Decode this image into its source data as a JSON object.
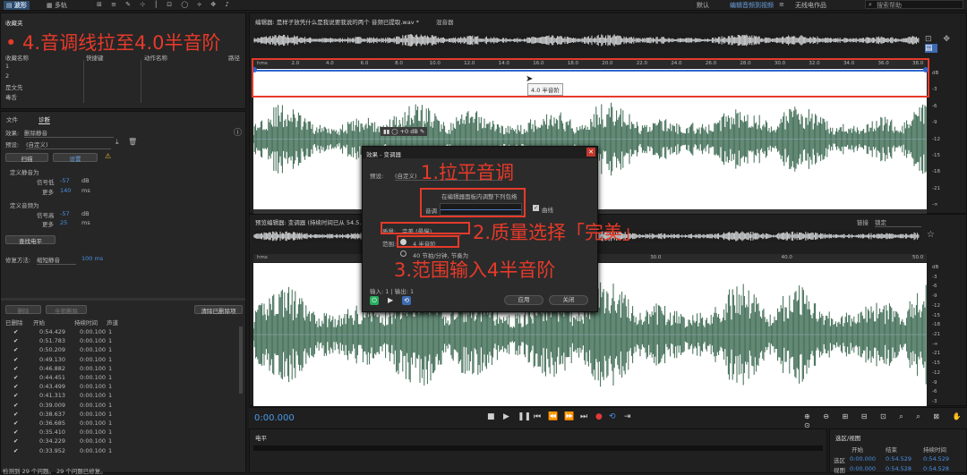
{
  "topbar": {
    "waveform_label": "波形",
    "multitrack_label": "多轨",
    "default_label": "默认",
    "workspace_label": "编辑音频到视频",
    "wireless_label": "无线电作品",
    "search_placeholder": "搜索帮助"
  },
  "favorites": {
    "title": "收藏夹",
    "col_name": "收藏名称",
    "col_shortcut": "快捷键",
    "col_action": "动作名称",
    "col_path": "路径",
    "items": [
      "1",
      "2",
      "是文先",
      "毒舌"
    ]
  },
  "diag": {
    "tab_file": "文件",
    "tab_diag": "诊断",
    "effect_label": "效果:",
    "effect_value": "删除静音",
    "preset_label": "预设:",
    "preset_value": "(自定义)",
    "scan_label": "扫描",
    "settings_label": "设置",
    "silence_group": "定义静音为",
    "signal_label": "信号低",
    "signal_value": "-57",
    "signal_unit": "dB",
    "more_label": "更多",
    "more_value1": "140",
    "ms1": "ms",
    "audio_group": "定义音频为",
    "signal2_label": "信号高",
    "signal2_value": "-57",
    "signal2_unit": "dB",
    "more2_label": "更多",
    "more_value2": "25",
    "ms2": "ms",
    "find_level": "查找电平",
    "fix_label": "修复方法:",
    "fix_value": "缩短静音",
    "fix_ms": "100 ms",
    "delete_btn": "删除",
    "delete_all_btn": "全部删除",
    "clear_btn": "清除已删除项",
    "col_deleted": "已删除",
    "col_start": "开始",
    "col_duration": "持续时间",
    "col_channel": "声道",
    "rows": [
      [
        "0:54.429",
        "0:00.100",
        "1"
      ],
      [
        "0:51.783",
        "0:00.100",
        "1"
      ],
      [
        "0:50.209",
        "0:00.100",
        "1"
      ],
      [
        "0:49.130",
        "0:00.100",
        "1"
      ],
      [
        "0:46.882",
        "0:00.100",
        "1"
      ],
      [
        "0:44.451",
        "0:00.100",
        "1"
      ],
      [
        "0:43.499",
        "0:00.100",
        "1"
      ],
      [
        "0:41.313",
        "0:00.100",
        "1"
      ],
      [
        "0:39.009",
        "0:00.100",
        "1"
      ],
      [
        "0:38.637",
        "0:00.100",
        "1"
      ],
      [
        "0:36.685",
        "0:00.100",
        "1"
      ],
      [
        "0:35.410",
        "0:00.100",
        "1"
      ],
      [
        "0:34.229",
        "0:00.100",
        "1"
      ],
      [
        "0:33.952",
        "0:00.100",
        "1"
      ]
    ],
    "status": "检测到 29 个问题。 29 个问题已修复。"
  },
  "editor": {
    "tab_title": "编辑器: 是样子放凭什么是我说要我说的两个 音频已提取.wav *",
    "mixer_tab": "混音器",
    "pitch_tooltip": "4.0 半音阶",
    "gain_label": "+0 dB",
    "ruler_marks": [
      "hms",
      "2.0",
      "4.0",
      "6.0",
      "8.0",
      "10.0",
      "12.0",
      "14.0",
      "16.0",
      "18.0",
      "20.0",
      "22.0",
      "24.0",
      "26.0",
      "28.0",
      "30.0",
      "32.0",
      "34.0",
      "36.0",
      "38.0"
    ],
    "db_marks": [
      "dB",
      "-3",
      "-6",
      "-9",
      "-12",
      "-15",
      "-18",
      "-21",
      "-∞"
    ]
  },
  "preview": {
    "title": "预览编辑器: 变调器 (持续时间已从 54.5...",
    "zoom_label": "链接",
    "zoom_value": "锁定",
    "ruler_marks": [
      "hms",
      "10.0",
      "20.0",
      "30.0",
      "40.0",
      "50.0"
    ],
    "db_marks": [
      "dB",
      "-3",
      "-6",
      "-9",
      "-12",
      "-15",
      "-18",
      "-21",
      "-∞",
      "-21",
      "-15",
      "-12",
      "-9",
      "-6",
      "-3"
    ]
  },
  "dialog": {
    "title": "效果 - 变调器",
    "preset_label": "预设:",
    "preset_value": "(自定义)",
    "instruction": "在编辑器面板内调整下列包络",
    "pitch_label": "音调",
    "curve_label": "曲线",
    "quality_label": "质量:",
    "quality_value": "完美 (最慢)",
    "range_label": "范围:",
    "range_value": "4 半音阶",
    "option_label": "40 节拍/分钟, 节奏为",
    "io_label": "输入: 1 | 输出: 1",
    "apply_btn": "应用",
    "close_btn": "关闭"
  },
  "transport": {
    "timecode": "0:00.000"
  },
  "levels": {
    "title": "电平"
  },
  "selection": {
    "title": "选区/视图",
    "col_start": "开始",
    "col_end": "结束",
    "col_duration": "持续时间",
    "sel_label": "选区",
    "sel_start": "0:00.000",
    "sel_end": "0:54.529",
    "sel_duration": "0:54.529",
    "view_label": "视图",
    "view_start": "0:00.000",
    "view_end": "0:54.528",
    "view_duration": "0:54.528"
  },
  "annotations": {
    "a4": "• 4.音调线拉至4.0半音阶",
    "a1": "1.拉平音调",
    "a2": "2.质量选择「完美」",
    "a3": "3.范围输入4半音阶"
  },
  "colors": {
    "wave": "#3c6a52",
    "annotation": "#e63a2a",
    "accent": "#4a90e2"
  }
}
